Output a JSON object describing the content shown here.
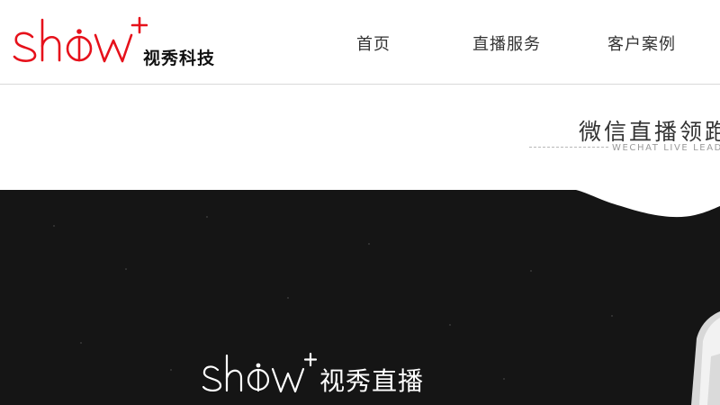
{
  "header": {
    "brand_sub": "视秀科技",
    "brand_color": "#e6111b",
    "nav": [
      {
        "label": "首页"
      },
      {
        "label": "直播服务"
      },
      {
        "label": "客户案例"
      }
    ]
  },
  "section": {
    "title": "微信直播领跑",
    "subtitle": "WECHAT LIVE LEADER"
  },
  "hero": {
    "background": "#151515",
    "logo_sub": "视秀直播"
  }
}
